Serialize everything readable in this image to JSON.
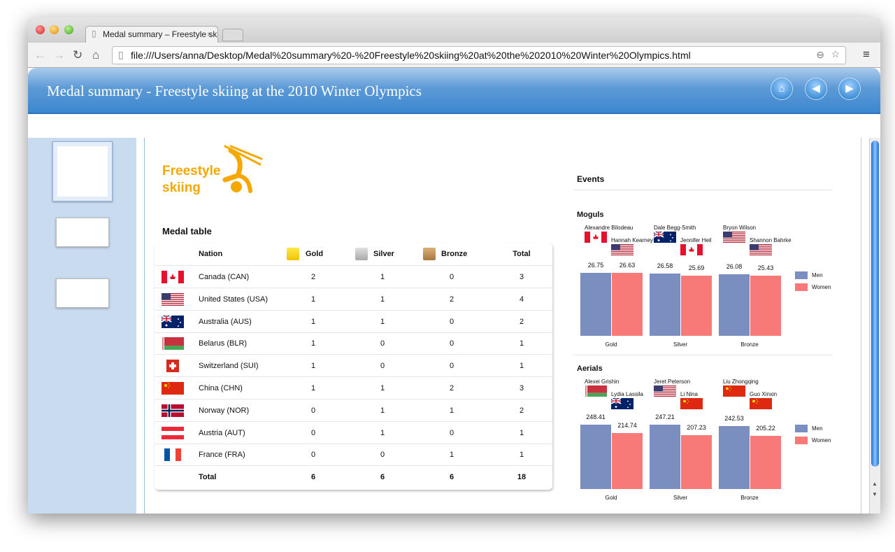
{
  "browser": {
    "tab_title": "Medal summary – Freestyle skiing",
    "url": "file:///Users/anna/Desktop/Medal%20summary%20-%20Freestyle%20skiing%20at%20the%202010%20Winter%20Olympics.html"
  },
  "header": {
    "title": "Medal summary - Freestyle skiing at the 2010 Winter Olympics"
  },
  "logo": {
    "line1": "Freestyle",
    "line2": "skiing"
  },
  "medal_table": {
    "title": "Medal table",
    "columns": [
      "Nation",
      "Gold",
      "Silver",
      "Bronze",
      "Total"
    ],
    "colors": {
      "gold": "#f5d000",
      "silver": "#b5b5b5",
      "bronze": "#b98a4e"
    },
    "rows": [
      {
        "code": "CAN",
        "nation": "Canada (CAN)",
        "gold": "2",
        "silver": "1",
        "bronze": "0",
        "total": "3"
      },
      {
        "code": "USA",
        "nation": "United States (USA)",
        "gold": "1",
        "silver": "1",
        "bronze": "2",
        "total": "4"
      },
      {
        "code": "AUS",
        "nation": "Australia (AUS)",
        "gold": "1",
        "silver": "1",
        "bronze": "0",
        "total": "2"
      },
      {
        "code": "BLR",
        "nation": "Belarus (BLR)",
        "gold": "1",
        "silver": "0",
        "bronze": "0",
        "total": "1"
      },
      {
        "code": "SUI",
        "nation": "Switzerland (SUI)",
        "gold": "1",
        "silver": "0",
        "bronze": "0",
        "total": "1"
      },
      {
        "code": "CHN",
        "nation": "China (CHN)",
        "gold": "1",
        "silver": "1",
        "bronze": "2",
        "total": "3"
      },
      {
        "code": "NOR",
        "nation": "Norway (NOR)",
        "gold": "0",
        "silver": "1",
        "bronze": "1",
        "total": "2"
      },
      {
        "code": "AUT",
        "nation": "Austria (AUT)",
        "gold": "0",
        "silver": "1",
        "bronze": "0",
        "total": "1"
      },
      {
        "code": "FRA",
        "nation": "France (FRA)",
        "gold": "0",
        "silver": "0",
        "bronze": "1",
        "total": "1"
      }
    ],
    "total": {
      "label": "Total",
      "gold": "6",
      "silver": "6",
      "bronze": "6",
      "total": "18"
    }
  },
  "events_title": "Events",
  "chart_data": [
    {
      "type": "bar",
      "title": "Moguls",
      "categories": [
        "Gold",
        "Silver",
        "Bronze"
      ],
      "series": [
        {
          "name": "Men",
          "color": "#7a8fbf",
          "values": [
            26.75,
            26.58,
            26.08
          ],
          "athletes": [
            "Alexandre Bilodeau",
            "Dale Begg-Smith",
            "Bryon Wilson"
          ],
          "flags": [
            "CAN",
            "AUS",
            "USA"
          ]
        },
        {
          "name": "Women",
          "color": "#f77a78",
          "values": [
            26.63,
            25.69,
            25.43
          ],
          "athletes": [
            "Hannah Kearney",
            "Jennifer Heil",
            "Shannon Bahrke"
          ],
          "flags": [
            "USA",
            "CAN",
            "USA"
          ]
        }
      ],
      "labels": {
        "men": [
          "26.75",
          "26.58",
          "26.08"
        ],
        "women": [
          "26.63",
          "25.69",
          "25.43"
        ]
      },
      "ylim": [
        0,
        26.75
      ],
      "legend": "right"
    },
    {
      "type": "bar",
      "title": "Aerials",
      "categories": [
        "Gold",
        "Silver",
        "Bronze"
      ],
      "series": [
        {
          "name": "Men",
          "color": "#7a8fbf",
          "values": [
            248.41,
            247.21,
            242.53
          ],
          "athletes": [
            "Alexei Grishin",
            "Jeret Peterson",
            "Liu Zhongqing"
          ],
          "flags": [
            "BLR",
            "USA",
            "CHN"
          ]
        },
        {
          "name": "Women",
          "color": "#f77a78",
          "values": [
            214.74,
            207.23,
            205.22
          ],
          "athletes": [
            "Lydia Lassila",
            "Li Nina",
            "Guo Xinxin"
          ],
          "flags": [
            "AUS",
            "CHN",
            "CHN"
          ]
        }
      ],
      "labels": {
        "men": [
          "248.41",
          "247.21",
          "242.53"
        ],
        "women": [
          "214.74",
          "207.23",
          "205.22"
        ]
      },
      "ylim": [
        0,
        248.41
      ],
      "legend": "right"
    }
  ]
}
